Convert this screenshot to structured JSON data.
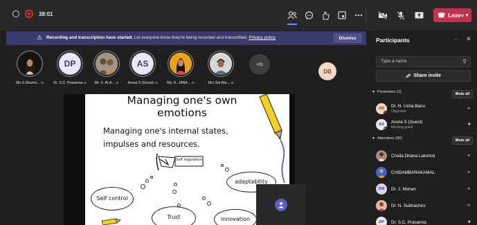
{
  "toolbar": {
    "timer": "38:01",
    "icons": [
      "shield-icon",
      "record-icon",
      "people-icon",
      "chat-icon",
      "react-icon",
      "rooms-icon",
      "more-icon",
      "camera-off-icon",
      "mic-off-icon",
      "share-icon"
    ],
    "leave_label": "Leave"
  },
  "banner": {
    "bold_text": "Recording and transcription have started.",
    "text": "Let everyone know they're being recorded and transcribed.",
    "link": "Privacy policy",
    "dismiss_label": "Dismiss"
  },
  "gallery": {
    "people": [
      {
        "name": "Ms.S.Sharmi...",
        "initials": ""
      },
      {
        "name": "Dr. S.C. Prasanna",
        "initials": "DP"
      },
      {
        "name": "Mr. S. ALA...",
        "initials": ""
      },
      {
        "name": "Aruna S (Guest)",
        "initials": "AS"
      },
      {
        "name": "Ms. K. JANA...",
        "initials": ""
      },
      {
        "name": "Mr.I.Sai Abr...",
        "initials": ""
      }
    ],
    "more_count": "+81",
    "self_initials": "DB"
  },
  "slide": {
    "title_line1": "Managing one's own",
    "title_line2": "emotions",
    "subtitle_line1": "Managing one's internal states,",
    "subtitle_line2": "impulses and resources.",
    "flag_text": "Self regulation",
    "cloud_adaptability": "adaptability",
    "cloud_self_control": "Self control",
    "cloud_trust": "Trust",
    "cloud_innovation": "innovation"
  },
  "participants": {
    "title": "Participants",
    "search_placeholder": "Type a name",
    "share_invite_label": "Share invite",
    "presenters_label": "Presenters (2)",
    "attendees_label": "Attendees (86)",
    "mute_all_label": "Mute all",
    "presenters": [
      {
        "name": "Dr. N. Usha Banu",
        "role": "Organizer",
        "initials": "DB"
      },
      {
        "name": "Aruna S (Guest)",
        "role": "Meeting guest",
        "initials": "AS"
      }
    ],
    "attendees": [
      {
        "name": "Challa Dhana Lakshmi",
        "initials": ""
      },
      {
        "name": "CHIDAMBARAKAMAL",
        "initials": ""
      },
      {
        "name": "Dr. J. Mohan",
        "initials": "DM"
      },
      {
        "name": "Dr. N. Subhashini",
        "initials": ""
      },
      {
        "name": "Dr. S.C. Prasanna",
        "initials": "DP"
      }
    ]
  },
  "colors": {
    "accent": "#5b5fc7",
    "banner_bg": "#3b3a6e",
    "leave_red": "#c4314b",
    "record_red": "#d13438"
  }
}
